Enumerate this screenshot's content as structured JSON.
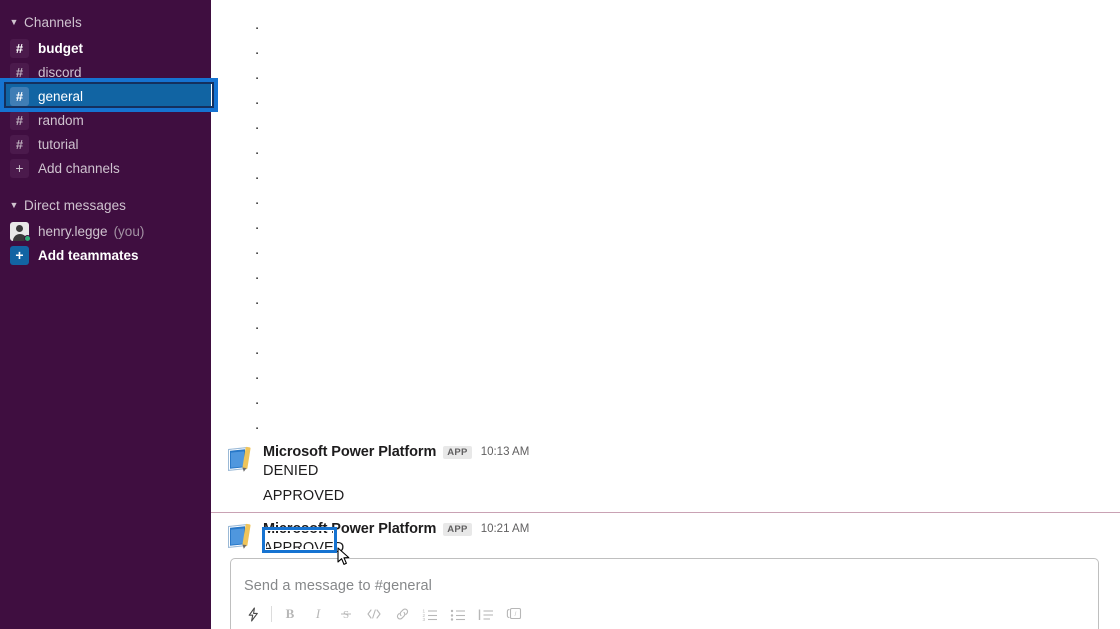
{
  "sidebar": {
    "channels_section": {
      "label": "Channels",
      "caret": "caret-down-icon"
    },
    "channels": [
      {
        "name": "budget",
        "icon": "hash-icon",
        "state": "unread"
      },
      {
        "name": "discord",
        "icon": "hash-icon",
        "state": "normal"
      },
      {
        "name": "general",
        "icon": "hash-icon",
        "state": "selected"
      },
      {
        "name": "random",
        "icon": "hash-icon",
        "state": "normal"
      },
      {
        "name": "tutorial",
        "icon": "hash-icon",
        "state": "normal"
      },
      {
        "name": "Add channels",
        "icon": "plus-icon",
        "state": "action"
      }
    ],
    "dm_section": {
      "label": "Direct messages",
      "caret": "caret-down-icon"
    },
    "dms": [
      {
        "name": "henry.legge",
        "suffix": "(you)",
        "icon": "avatar-icon",
        "presence": "active"
      }
    ],
    "add_teammates": {
      "label": "Add teammates",
      "icon": "plus-icon"
    }
  },
  "colors": {
    "sidebar_bg": "#3F0E40",
    "selected_channel_bg": "#1164A3",
    "highlight_border": "#1673D1",
    "divider_pink": "#C9A2B4",
    "app_badge_bg": "#E8E8E8",
    "presence_green": "#2BAC76"
  },
  "main": {
    "filler_messages": [
      {
        "text": "."
      },
      {
        "text": "."
      },
      {
        "text": "."
      },
      {
        "text": "."
      },
      {
        "text": "."
      },
      {
        "text": "."
      },
      {
        "text": "."
      },
      {
        "text": "."
      },
      {
        "text": "."
      },
      {
        "text": "."
      },
      {
        "text": "."
      },
      {
        "text": "."
      },
      {
        "text": "."
      },
      {
        "text": "."
      },
      {
        "text": "."
      },
      {
        "text": "."
      },
      {
        "text": "."
      }
    ],
    "messages": [
      {
        "author": "Microsoft Power Platform",
        "badge": "APP",
        "time": "10:13 AM",
        "avatar_icon": "power-platform-app-icon",
        "lines": [
          "DENIED",
          "APPROVED"
        ]
      },
      {
        "author": "Microsoft Power Platform",
        "badge": "APP",
        "time": "10:21 AM",
        "avatar_icon": "power-platform-app-icon",
        "lines": [
          "APPROVED"
        ]
      }
    ]
  },
  "composer": {
    "placeholder": "Send a message to #general",
    "toolbar": [
      {
        "name": "shortcuts-lightning-icon",
        "glyph": "lightning"
      },
      {
        "name": "bold-button",
        "glyph": "B"
      },
      {
        "name": "italic-button",
        "glyph": "I"
      },
      {
        "name": "strikethrough-button",
        "glyph": "S"
      },
      {
        "name": "code-button",
        "glyph": "code"
      },
      {
        "name": "link-button",
        "glyph": "link"
      },
      {
        "name": "ordered-list-button",
        "glyph": "ol"
      },
      {
        "name": "bulleted-list-button",
        "glyph": "ul"
      },
      {
        "name": "blockquote-button",
        "glyph": "quote"
      },
      {
        "name": "code-block-button",
        "glyph": "codeblock"
      }
    ]
  },
  "annotations": {
    "channel_highlight_target": "general",
    "message_highlight_target": "APPROVED"
  }
}
